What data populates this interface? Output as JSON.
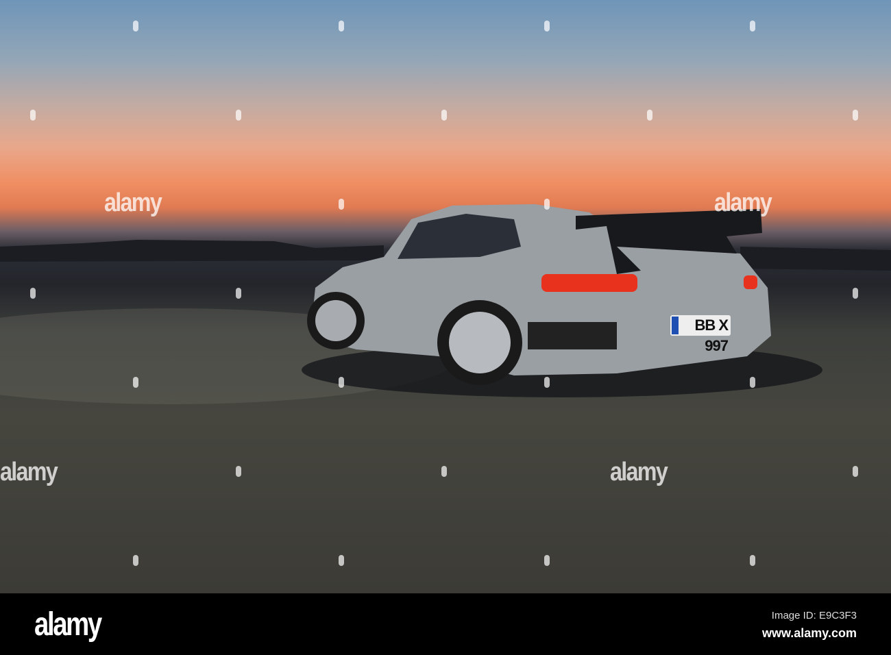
{
  "photo": {
    "subject": "Silver sports car on airfield at dusk",
    "license_plate": "BB X 997"
  },
  "watermark": {
    "text": "alamy"
  },
  "footer": {
    "logo": "alamy",
    "image_id": "Image ID: E9C3F3",
    "url": "www.alamy.com"
  }
}
